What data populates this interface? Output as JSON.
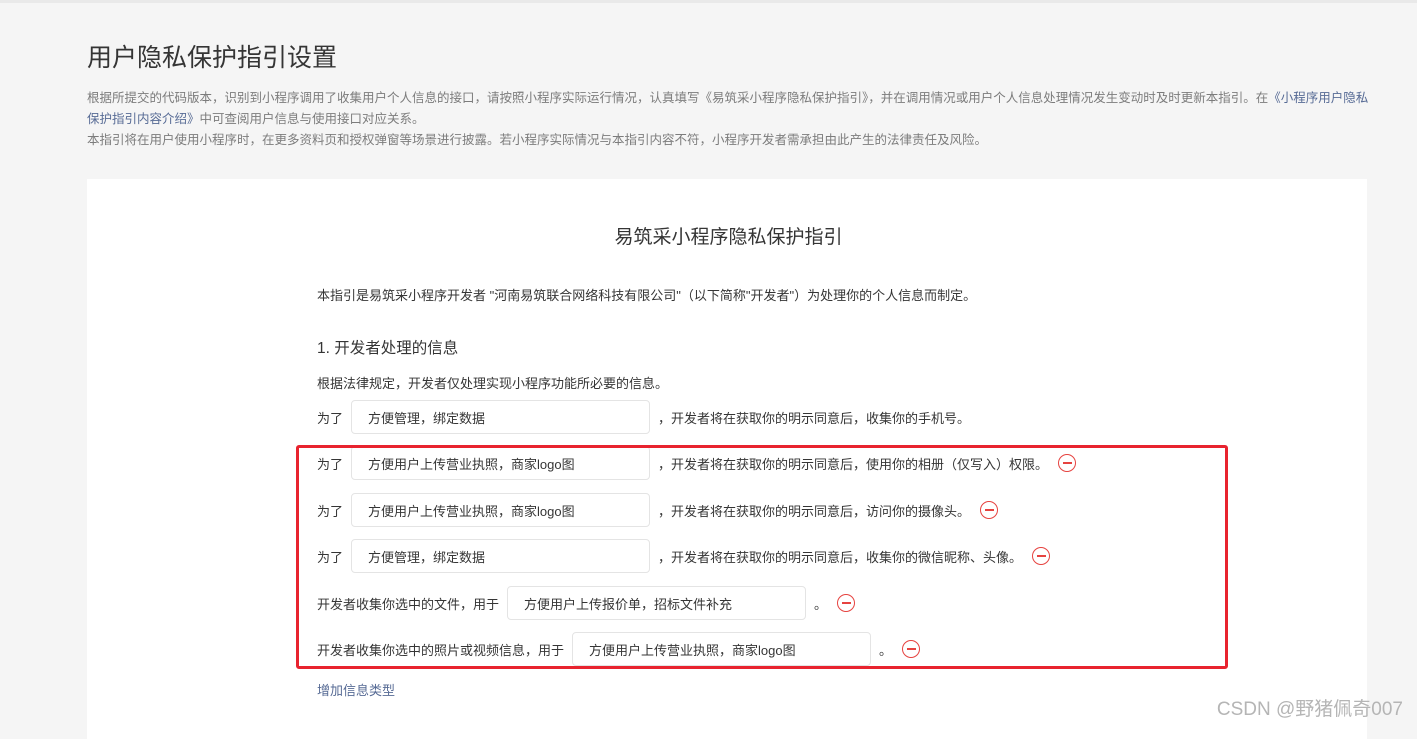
{
  "page_title": "用户隐私保护指引设置",
  "description": {
    "line1_part1": "根据所提交的代码版本，识别到小程序调用了收集用户个人信息的接口，请按照小程序实际运行情况，认真填写《易筑采小程序隐私保护指引》，并在调用情况或用户个人信息处理情况发生变动时及时更新本指引。在",
    "link": "《小程序用户隐私保护指引内容介绍》",
    "line1_part2": "中可查阅用户信息与使用接口对应关系。",
    "line2": "本指引将在用户使用小程序时，在更多资料页和授权弹窗等场景进行披露。若小程序实际情况与本指引内容不符，小程序开发者需承担由此产生的法律责任及风险。"
  },
  "guide": {
    "title": "易筑采小程序隐私保护指引",
    "intro": "本指引是易筑采小程序开发者 \"河南易筑联合网络科技有限公司\"（以下简称\"开发者\"）为处理你的个人信息而制定。",
    "section1_title": "1. 开发者处理的信息",
    "section1_desc": "根据法律规定，开发者仅处理实现小程序功能所必要的信息。"
  },
  "rows": [
    {
      "prefix": "为了",
      "value": "方便管理，绑定数据",
      "suffix": "，开发者将在获取你的明示同意后，收集你的手机号。"
    },
    {
      "prefix": "为了",
      "value": "方便用户上传营业执照，商家logo图",
      "suffix": "，开发者将在获取你的明示同意后，使用你的相册（仅写入）权限。"
    },
    {
      "prefix": "为了",
      "value": "方便用户上传营业执照，商家logo图",
      "suffix": "，开发者将在获取你的明示同意后，访问你的摄像头。"
    },
    {
      "prefix": "为了",
      "value": "方便管理，绑定数据",
      "suffix": "，开发者将在获取你的明示同意后，收集你的微信昵称、头像。"
    },
    {
      "prefix": "开发者收集你选中的文件，用于",
      "value": "方便用户上传报价单，招标文件补充",
      "suffix": "。"
    },
    {
      "prefix": "开发者收集你选中的照片或视频信息，用于",
      "value": "方便用户上传营业执照，商家logo图",
      "suffix": "。"
    }
  ],
  "add_link": "增加信息类型",
  "watermark": "CSDN @野猪佩奇007",
  "colors": {
    "link": "#576b95",
    "remove_icon": "#e64340",
    "highlight_box": "#e8232f"
  }
}
